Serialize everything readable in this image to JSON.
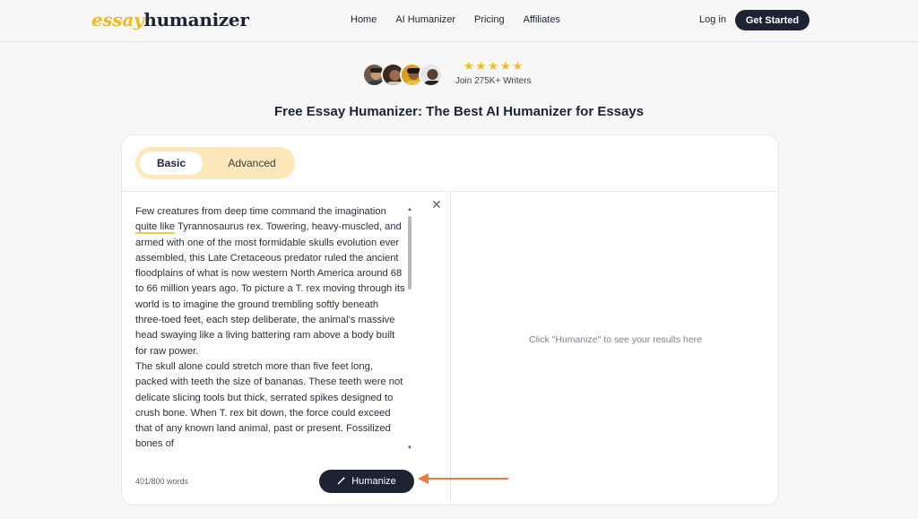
{
  "logo": {
    "part1": "essay",
    "part2": "humanizer"
  },
  "nav": [
    "Home",
    "AI Humanizer",
    "Pricing",
    "Affiliates"
  ],
  "header": {
    "login": "Log in",
    "cta": "Get Started"
  },
  "hero": {
    "stars": "★★★★★",
    "join_text": "Join 275K+ Writers",
    "title": "Free Essay Humanizer: The Best AI Humanizer for Essays"
  },
  "tabs": {
    "basic": "Basic",
    "advanced": "Advanced"
  },
  "editor": {
    "text_before": "Few creatures from deep time command the imagination ",
    "underlined": "quite like",
    "text_after": " Tyrannosaurus rex. Towering, heavy-muscled, and armed with one of the most formidable skulls evolution ever assembled, this Late Cretaceous predator ruled the ancient floodplains of what is now western North America around 68 to 66 million years ago. To picture a T. rex moving through its world is to imagine the ground trembling softly beneath three-toed feet, each step deliberate, the animal's massive head swaying like a living battering ram above a body built for raw power.",
    "paragraph2": "The skull alone could stretch more than five feet long, packed with teeth the size of bananas. These teeth were not delicate slicing tools but thick, serrated spikes designed to crush bone. When T. rex bit down, the force could exceed that of any known land animal, past or present. Fossilized bones of"
  },
  "word_count": "401/800 words",
  "humanize_button": "Humanize",
  "results_placeholder": "Click \"Humanize\" to see your results here",
  "colors": {
    "accent": "#f2b91c",
    "dark": "#1c2433",
    "tab_bg": "#fde8bb",
    "arrow": "#f07a3c"
  },
  "icons": {
    "clear": "close-icon",
    "humanize": "magic-wand-icon",
    "rating": "star-icon"
  }
}
